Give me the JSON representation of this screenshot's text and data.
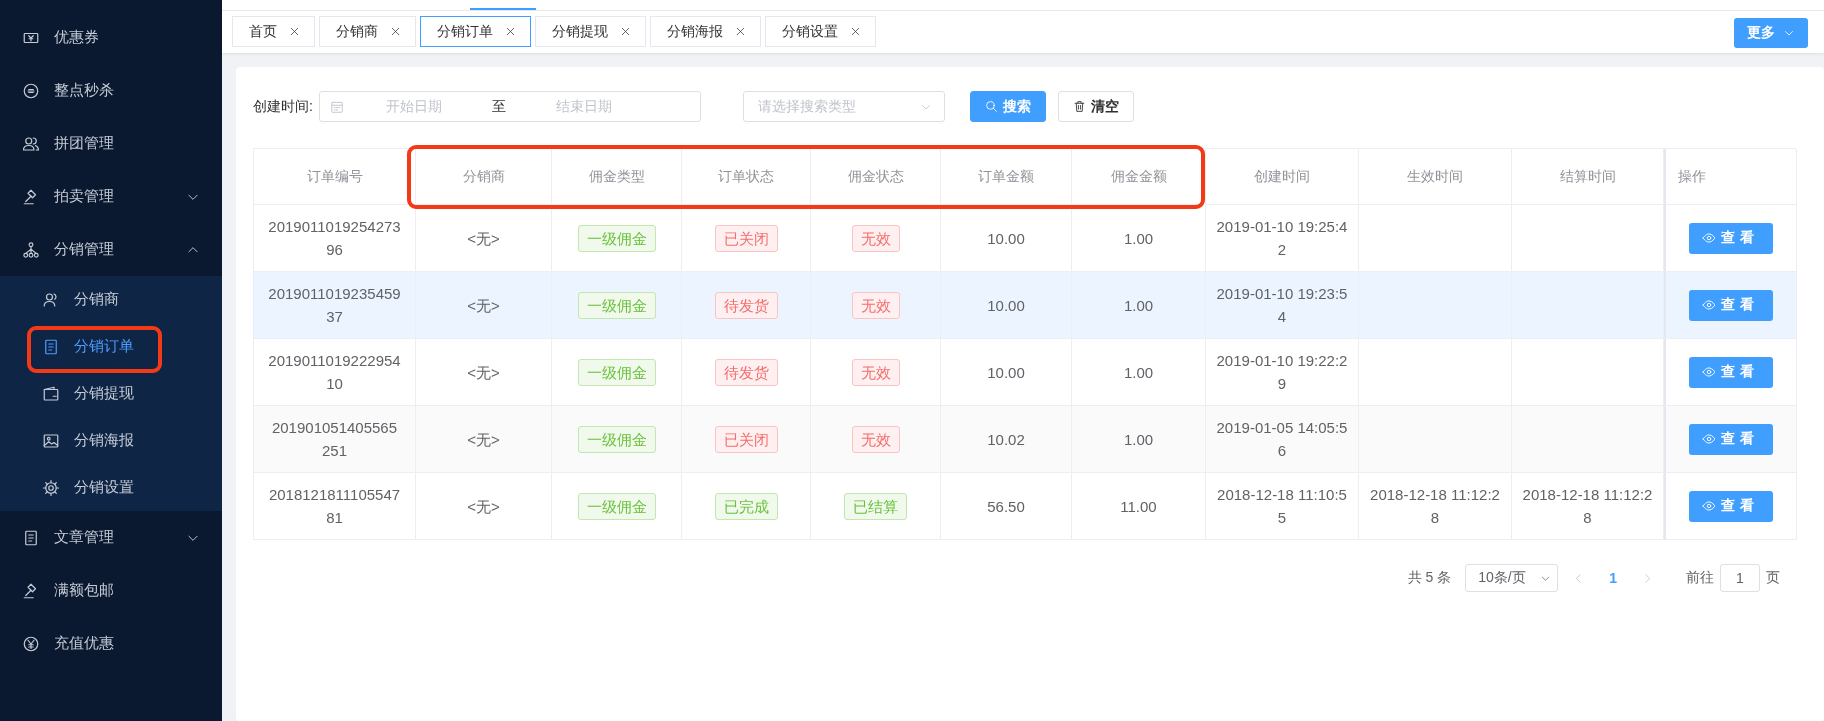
{
  "sidebar": {
    "items": [
      {
        "label": "优惠券",
        "selected": false
      },
      {
        "label": "整点秒杀",
        "selected": false
      },
      {
        "label": "拼团管理",
        "selected": false
      },
      {
        "label": "拍卖管理",
        "selected": false,
        "expanded": false
      },
      {
        "label": "分销管理",
        "selected": false,
        "expanded": true,
        "children": [
          {
            "label": "分销商",
            "selected": false
          },
          {
            "label": "分销订单",
            "selected": true
          },
          {
            "label": "分销提现",
            "selected": false
          },
          {
            "label": "分销海报",
            "selected": false
          },
          {
            "label": "分销设置",
            "selected": false
          }
        ]
      },
      {
        "label": "文章管理",
        "selected": false,
        "expanded": false
      },
      {
        "label": "满额包邮",
        "selected": false
      },
      {
        "label": "充值优惠",
        "selected": false
      }
    ]
  },
  "tabs": [
    {
      "label": "首页",
      "selected": false
    },
    {
      "label": "分销商",
      "selected": false
    },
    {
      "label": "分销订单",
      "selected": true
    },
    {
      "label": "分销提现",
      "selected": false
    },
    {
      "label": "分销海报",
      "selected": false
    },
    {
      "label": "分销设置",
      "selected": false
    }
  ],
  "more_button": "更多",
  "filter": {
    "date_label": "创建时间:",
    "start_placeholder": "开始日期",
    "range_separator": "至",
    "end_placeholder": "结束日期",
    "type_placeholder": "请选择搜索类型",
    "search_button": "搜索",
    "clear_button": "清空"
  },
  "table": {
    "columns": [
      "订单编号",
      "分销商",
      "佣金类型",
      "订单状态",
      "佣金状态",
      "订单金额",
      "佣金金额",
      "创建时间",
      "生效时间",
      "结算时间",
      "操作"
    ],
    "rows": [
      {
        "highlighted": false,
        "order_no": "201901101925427396",
        "distributor": "<无>",
        "commission_type": {
          "label": "一级佣金",
          "kind": "success"
        },
        "order_status": {
          "label": "已关闭",
          "kind": "danger"
        },
        "commission_status": {
          "label": "无效",
          "kind": "danger"
        },
        "order_amount": "10.00",
        "commission_amount": "1.00",
        "created": "2019-01-10 19:25:42",
        "action": "查看"
      },
      {
        "highlighted": true,
        "order_no": "201901101923545937",
        "distributor": "<无>",
        "commission_type": {
          "label": "一级佣金",
          "kind": "success"
        },
        "order_status": {
          "label": "待发货",
          "kind": "danger"
        },
        "commission_status": {
          "label": "无效",
          "kind": "danger"
        },
        "order_amount": "10.00",
        "commission_amount": "1.00",
        "created": "2019-01-10 19:23:54",
        "action": "查看"
      },
      {
        "highlighted": false,
        "order_no": "201901101922295410",
        "distributor": "<无>",
        "commission_type": {
          "label": "一级佣金",
          "kind": "success"
        },
        "order_status": {
          "label": "待发货",
          "kind": "danger"
        },
        "commission_status": {
          "label": "无效",
          "kind": "danger"
        },
        "order_amount": "10.00",
        "commission_amount": "1.00",
        "created": "2019-01-10 19:22:29",
        "action": "查看"
      },
      {
        "highlighted": false,
        "order_no": "201901051405565251",
        "distributor": "<无>",
        "commission_type": {
          "label": "一级佣金",
          "kind": "success"
        },
        "order_status": {
          "label": "已关闭",
          "kind": "danger"
        },
        "commission_status": {
          "label": "无效",
          "kind": "danger"
        },
        "order_amount": "10.02",
        "commission_amount": "1.00",
        "created": "2019-01-05 14:05:56",
        "action": "查看"
      },
      {
        "highlighted": false,
        "order_no": "201812181110554781",
        "distributor": "<无>",
        "commission_type": {
          "label": "一级佣金",
          "kind": "success"
        },
        "order_status": {
          "label": "已完成",
          "kind": "success"
        },
        "commission_status": {
          "label": "已结算",
          "kind": "success"
        },
        "order_amount": "56.50",
        "commission_amount": "11.00",
        "created": "2018-12-18 11:10:55",
        "effective": "2018-12-18 11:12:28",
        "settled": "2018-12-18 11:12:28",
        "action": "查看"
      }
    ]
  },
  "pagination": {
    "total": "共 5 条",
    "page_size": "10条/页",
    "pages": [
      {
        "label": "1",
        "selected": true
      }
    ],
    "goto_label": "前往",
    "goto_value": "1",
    "goto_suffix": "页"
  }
}
